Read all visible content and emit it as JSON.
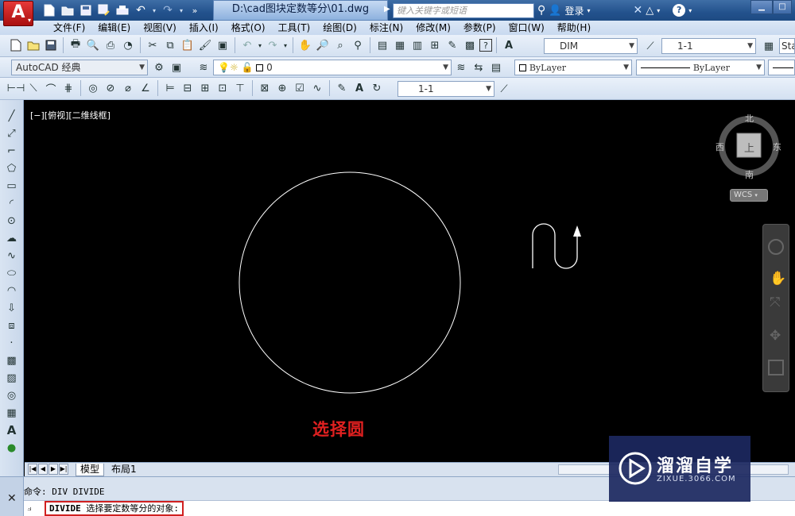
{
  "titlebar": {
    "document_title": "D:\\cad图块定数等分\\01.dwg",
    "search_placeholder": "键入关键字或短语",
    "login_label": "登录"
  },
  "menu": [
    "文件(F)",
    "编辑(E)",
    "视图(V)",
    "插入(I)",
    "格式(O)",
    "工具(T)",
    "绘图(D)",
    "标注(N)",
    "修改(M)",
    "参数(P)",
    "窗口(W)",
    "帮助(H)"
  ],
  "toolbar1": {
    "dim_style": "DIM",
    "scale_value": "1-1",
    "style_truncated": "Sta"
  },
  "toolbar2": {
    "workspace": "AutoCAD 经典",
    "layer_value": "0",
    "color": "ByLayer",
    "linetype": "ByLayer"
  },
  "toolbar3": {
    "scale_value": "1-1"
  },
  "viewport": {
    "label": "[−][俯视][二维线框]",
    "caption": "选择圆"
  },
  "viewcube": {
    "north": "北",
    "south": "南",
    "east": "东",
    "west": "西",
    "top": "上",
    "wcs": "WCS"
  },
  "tabs": {
    "model": "模型",
    "layout1": "布局1"
  },
  "command": {
    "history": "命令: DIV DIVIDE",
    "prompt_cmd": "DIVIDE",
    "prompt_text": "选择要定数等分的对象:"
  },
  "watermark": {
    "title": "溜溜自学",
    "subtitle": "ZIXUE.3066.COM"
  },
  "colors": {
    "title_bar": "#23528d",
    "caption_red": "#e02020",
    "drawing_bg": "#000000",
    "watermark_bg": "#1c285f"
  }
}
